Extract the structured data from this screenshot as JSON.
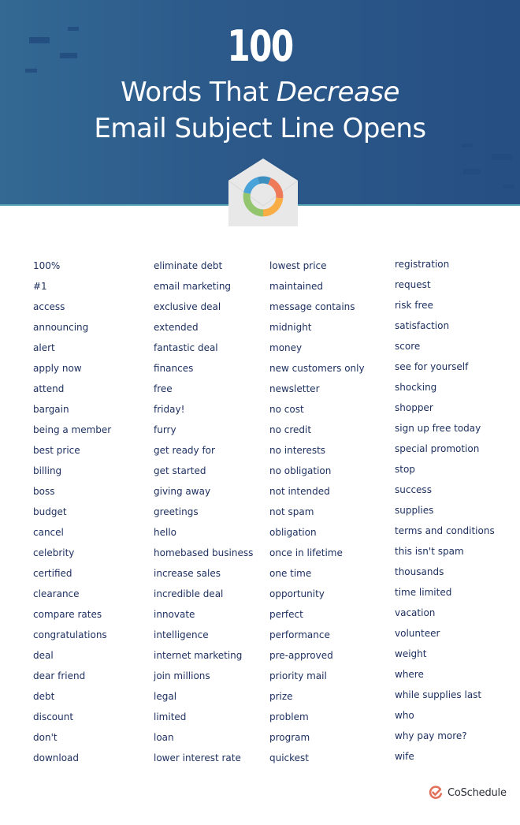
{
  "header": {
    "number": "100",
    "title_line1_prefix": "Words That ",
    "title_line1_emphasis": "Decrease",
    "title_line2": "Email Subject Line Opens",
    "colors": {
      "background_left": "#336993",
      "background_right": "#264f84",
      "accent_line": "#5aa7b8",
      "text": "#ffffff"
    }
  },
  "envelope_icon": {
    "name": "envelope-with-ring-chart-icon",
    "ring_colors": [
      "#4aa3d8",
      "#ef7a5a",
      "#f8ad45",
      "#93c46e"
    ]
  },
  "word_columns": [
    {
      "words": [
        "100%",
        "#1",
        "access",
        "announcing",
        "alert",
        "apply now",
        "attend",
        "bargain",
        "being a member",
        "best price",
        "billing",
        "boss",
        "budget",
        "cancel",
        "celebrity",
        "certified",
        "clearance",
        "compare rates",
        "congratulations",
        "deal",
        "dear friend",
        "debt",
        "discount",
        "don't",
        "download"
      ]
    },
    {
      "words": [
        "eliminate debt",
        "email marketing",
        "exclusive deal",
        "extended",
        "fantastic deal",
        "finances",
        "free",
        "friday!",
        "furry",
        "get ready for",
        "get started",
        "giving away",
        "greetings",
        "hello",
        "homebased business",
        "increase sales",
        "incredible deal",
        "innovate",
        "intelligence",
        "internet marketing",
        "join millions",
        "legal",
        "limited",
        "loan",
        "lower interest rate"
      ]
    },
    {
      "words": [
        "lowest price",
        "maintained",
        "message contains",
        "midnight",
        "money",
        "new customers only",
        "newsletter",
        "no cost",
        "no credit",
        "no interests",
        "no obligation",
        "not intended",
        "not spam",
        "obligation",
        "once in lifetime",
        "one time",
        "opportunity",
        "perfect",
        "performance",
        "pre-approved",
        "priority mail",
        "prize",
        "problem",
        "program",
        "quickest"
      ]
    },
    {
      "words": [
        "registration",
        "request",
        "risk free",
        "satisfaction",
        "score",
        "see for yourself",
        "shocking",
        "shopper",
        "sign up free today",
        "special promotion",
        "stop",
        "success",
        "supplies",
        "terms and conditions",
        "this isn't spam",
        "thousands",
        "time limited",
        "vacation",
        "volunteer",
        "weight",
        "where",
        "while supplies last",
        "who",
        "why pay more?",
        "wife"
      ]
    }
  ],
  "word_color": "#1b2e5e",
  "footer": {
    "brand": "CoSchedule",
    "brand_icon": "coschedule-check-icon",
    "brand_color": "#e2725b"
  }
}
